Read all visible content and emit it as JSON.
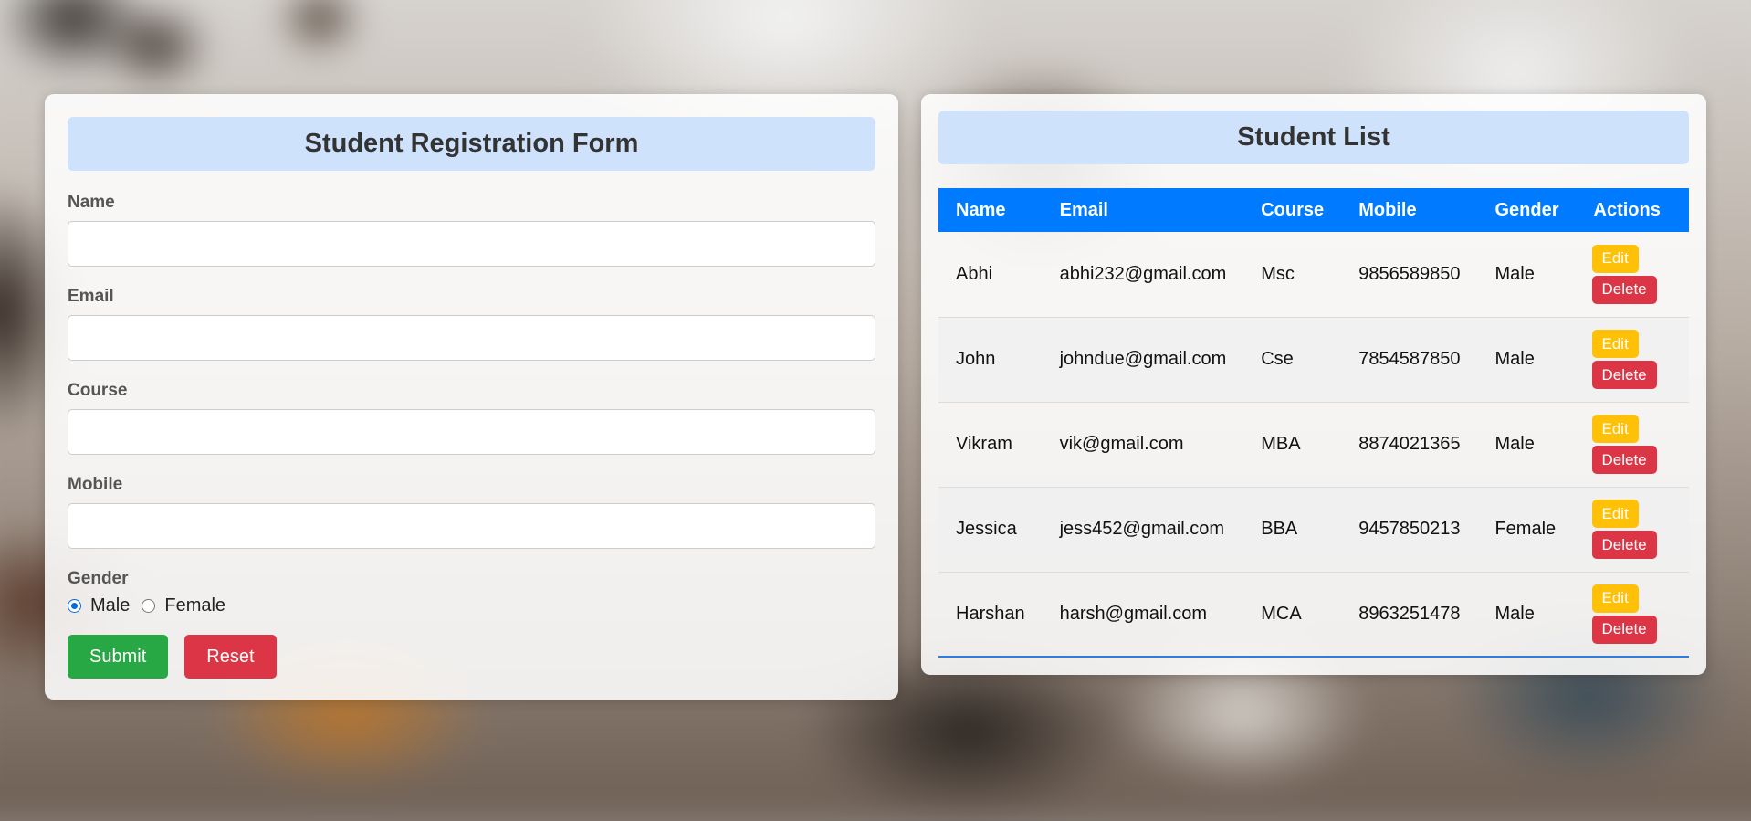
{
  "form": {
    "title": "Student Registration Form",
    "name_label": "Name",
    "email_label": "Email",
    "course_label": "Course",
    "mobile_label": "Mobile",
    "gender_label": "Gender",
    "name_value": "",
    "email_value": "",
    "course_value": "",
    "mobile_value": "",
    "gender_options": [
      "Male",
      "Female"
    ],
    "gender_selected": "Male",
    "submit_label": "Submit",
    "reset_label": "Reset"
  },
  "list": {
    "title": "Student List",
    "columns": [
      "Name",
      "Email",
      "Course",
      "Mobile",
      "Gender",
      "Actions"
    ],
    "edit_label": "Edit",
    "delete_label": "Delete",
    "rows": [
      {
        "name": "Abhi",
        "email": "abhi232@gmail.com",
        "course": "Msc",
        "mobile": "9856589850",
        "gender": "Male"
      },
      {
        "name": "John",
        "email": "johndue@gmail.com",
        "course": "Cse",
        "mobile": "7854587850",
        "gender": "Male"
      },
      {
        "name": "Vikram",
        "email": "vik@gmail.com",
        "course": "MBA",
        "mobile": "8874021365",
        "gender": "Male"
      },
      {
        "name": "Jessica",
        "email": "jess452@gmail.com",
        "course": "BBA",
        "mobile": "9457850213",
        "gender": "Female"
      },
      {
        "name": "Harshan",
        "email": "harsh@gmail.com",
        "course": "MCA",
        "mobile": "8963251478",
        "gender": "Male"
      }
    ]
  },
  "colors": {
    "header_blue": "#007bff",
    "heading_bg": "#cfe2fb",
    "submit_green": "#28a745",
    "delete_red": "#dc3545",
    "edit_yellow": "#ffc107"
  }
}
